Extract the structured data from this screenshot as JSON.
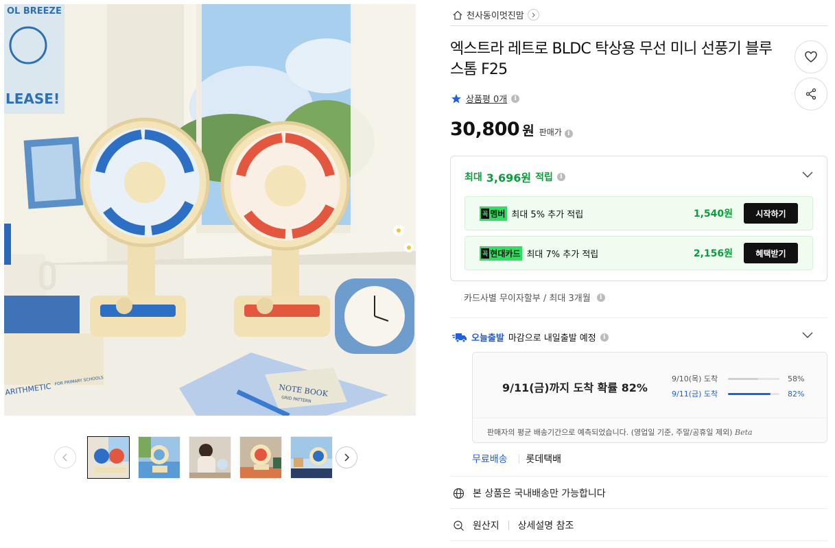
{
  "seller": {
    "name": "천사동이멋진맘"
  },
  "product": {
    "title": "엑스트라 레트로 BLDC 탁상용 무선 미니 선풍기 블루스톰 F25",
    "review_label": "상품평 0개",
    "price": "30,800",
    "currency": "원",
    "price_label": "판매가"
  },
  "reward": {
    "prefix": "최대",
    "amount": "3,696원",
    "suffix": "적립",
    "promos": [
      {
        "badge": "멤버",
        "text": "최대 5% 추가 적립",
        "amount": "1,540원",
        "action": "시작하기"
      },
      {
        "badge": "현대카드",
        "text": "최대 7% 추가 적립",
        "amount": "2,156원",
        "action": "혜택받기"
      }
    ]
  },
  "installment": {
    "text": "카드사별 무이자할부 / 최대 3개월"
  },
  "shipping": {
    "today_label": "오늘출발",
    "today_text": "마감으로 내일출발 예정",
    "headline": "9/11(금)까지 도착 확률 82%",
    "probabilities": [
      {
        "date": "9/10(목) 도착",
        "percent": 58,
        "pct_label": "58%"
      },
      {
        "date": "9/11(금) 도착",
        "percent": 82,
        "pct_label": "82%"
      }
    ],
    "note": "판매자의 평균 배송기간으로 예측되었습니다. (영업일 기준, 주말/공휴일 제외)",
    "beta": "Beta",
    "free_label": "무료배송",
    "carrier": "롯데택배"
  },
  "domestic": {
    "text": "본 상품은 국내배송만 가능합니다"
  },
  "origin": {
    "label": "원산지",
    "value": "상세설명 참조"
  },
  "image_text": {
    "poster_top": "OL BREEZE",
    "poster_bottom": "LEASE!",
    "book": "ARITHMETIC",
    "book_sub": "FOR PRIMARY SCHOOLS",
    "notebook": "NOTE BOOK",
    "notebook_sub": "GRID PATTERN"
  },
  "colors": {
    "green": "#0a9d3a",
    "blue": "#1e5fe0",
    "badge_green": "#2ee062"
  }
}
